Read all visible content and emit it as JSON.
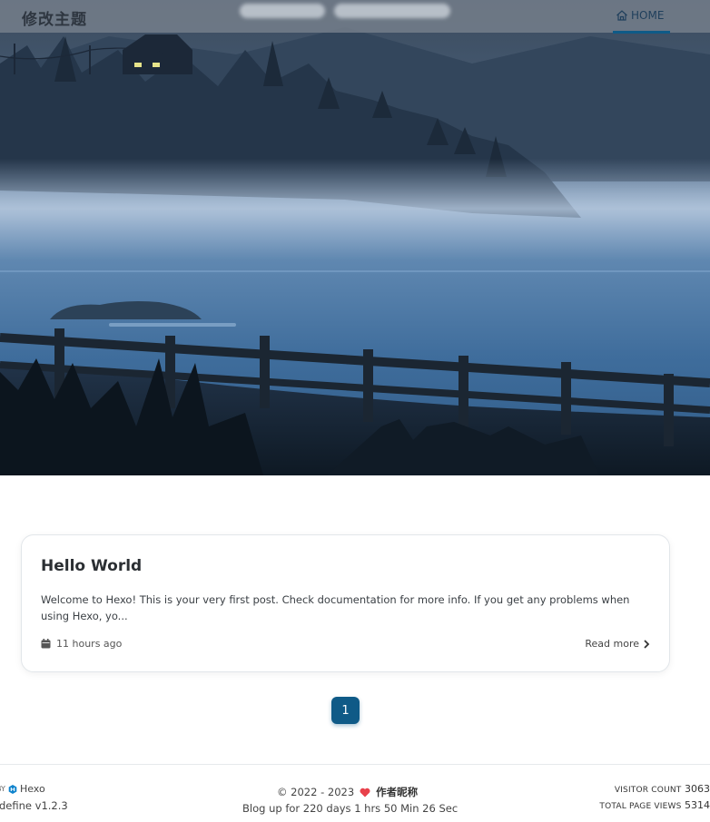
{
  "header": {
    "site_title": "修改主题",
    "nav": {
      "home_label": "HOME"
    }
  },
  "post": {
    "title": "Hello World",
    "excerpt": "Welcome to Hexo! This is your very first post. Check documentation for more info. If you get any problems when using Hexo, yo...",
    "time": "11 hours ago",
    "read_more": "Read more"
  },
  "pagination": {
    "current": "1"
  },
  "footer": {
    "powered_by_prefix": "BY",
    "powered_by_name": "Hexo",
    "theme": "define v1.2.3",
    "copyright": "© 2022 - 2023",
    "author": "作者昵称",
    "uptime": "Blog up for 220 days 1 hrs 50 Min 26 Sec",
    "visitor_label": "VISITOR COUNT",
    "visitor_value": "3063",
    "pageviews_label": "TOTAL PAGE VIEWS",
    "pageviews_value": "5314"
  },
  "colors": {
    "accent": "#0f5a87",
    "heart": "#e8414b"
  }
}
